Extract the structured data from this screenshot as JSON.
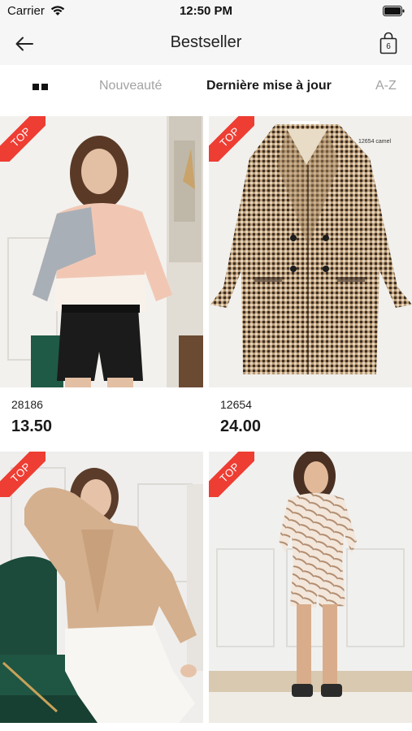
{
  "status_bar": {
    "carrier": "Carrier",
    "time": "12:50 PM"
  },
  "nav_bar": {
    "title": "Bestseller",
    "cart_count": "6"
  },
  "sort_tabs": [
    {
      "label": "Nouveauté",
      "active": false
    },
    {
      "label": "Dernière mise à jour",
      "active": true
    },
    {
      "label": "A-Z",
      "active": false
    }
  ],
  "products": [
    {
      "code": "28186",
      "price": "13.50",
      "badge": "TOP",
      "image": "woman in pastel colour-block sweater and black leather shorts"
    },
    {
      "code": "12654",
      "price": "24.00",
      "badge": "TOP",
      "image": "houndstooth camel coat",
      "tag_text": "12654 camel"
    },
    {
      "code": "",
      "price": "",
      "badge": "TOP",
      "image": "woman in beige cardigan on green velvet chair"
    },
    {
      "code": "",
      "price": "",
      "badge": "TOP",
      "image": "woman in zebra print sweatshirt and shorts"
    }
  ],
  "colors": {
    "accent_badge": "#ee3d33",
    "active_tab": "#1a1a1a",
    "inactive_tab": "#a3a3a3",
    "bar_background": "#f6f6f6"
  }
}
